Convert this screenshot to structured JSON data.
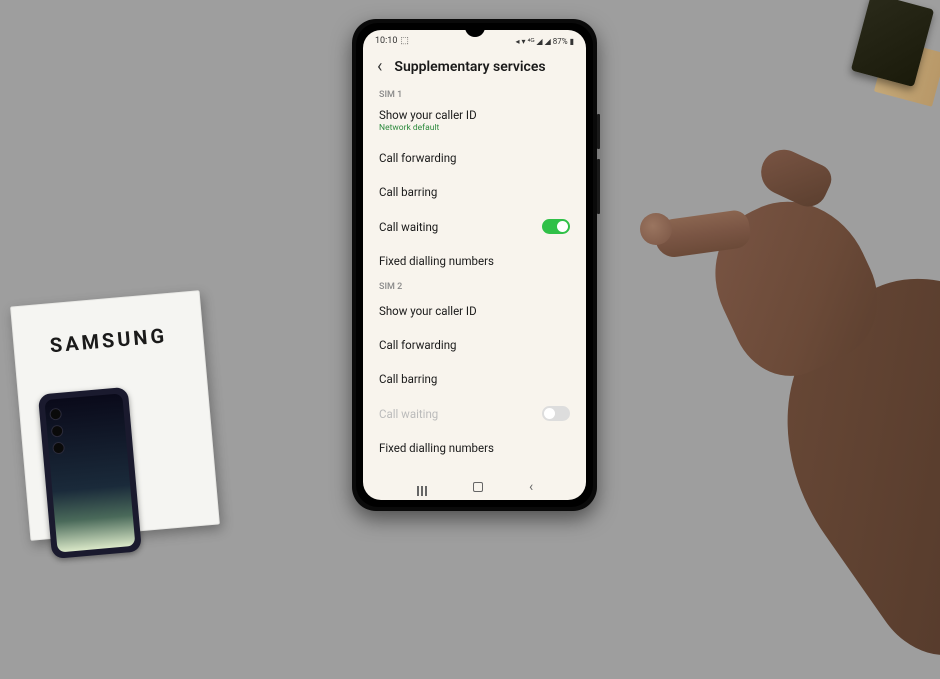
{
  "box": {
    "brand": "SAMSUNG"
  },
  "status": {
    "time": "10:10",
    "battery": "87%"
  },
  "header": {
    "title": "Supplementary services"
  },
  "sim1": {
    "label": "SIM 1",
    "caller_id": {
      "label": "Show your caller ID",
      "sub": "Network default"
    },
    "forwarding": "Call forwarding",
    "barring": "Call barring",
    "waiting": {
      "label": "Call waiting",
      "on": true
    },
    "fdn": "Fixed dialling numbers"
  },
  "sim2": {
    "label": "SIM 2",
    "caller_id": "Show your caller ID",
    "forwarding": "Call forwarding",
    "barring": "Call barring",
    "waiting": {
      "label": "Call waiting",
      "on": false
    },
    "fdn": "Fixed dialling numbers"
  },
  "colors": {
    "toggle_on": "#30c048",
    "sub_green": "#2e8b3e"
  }
}
